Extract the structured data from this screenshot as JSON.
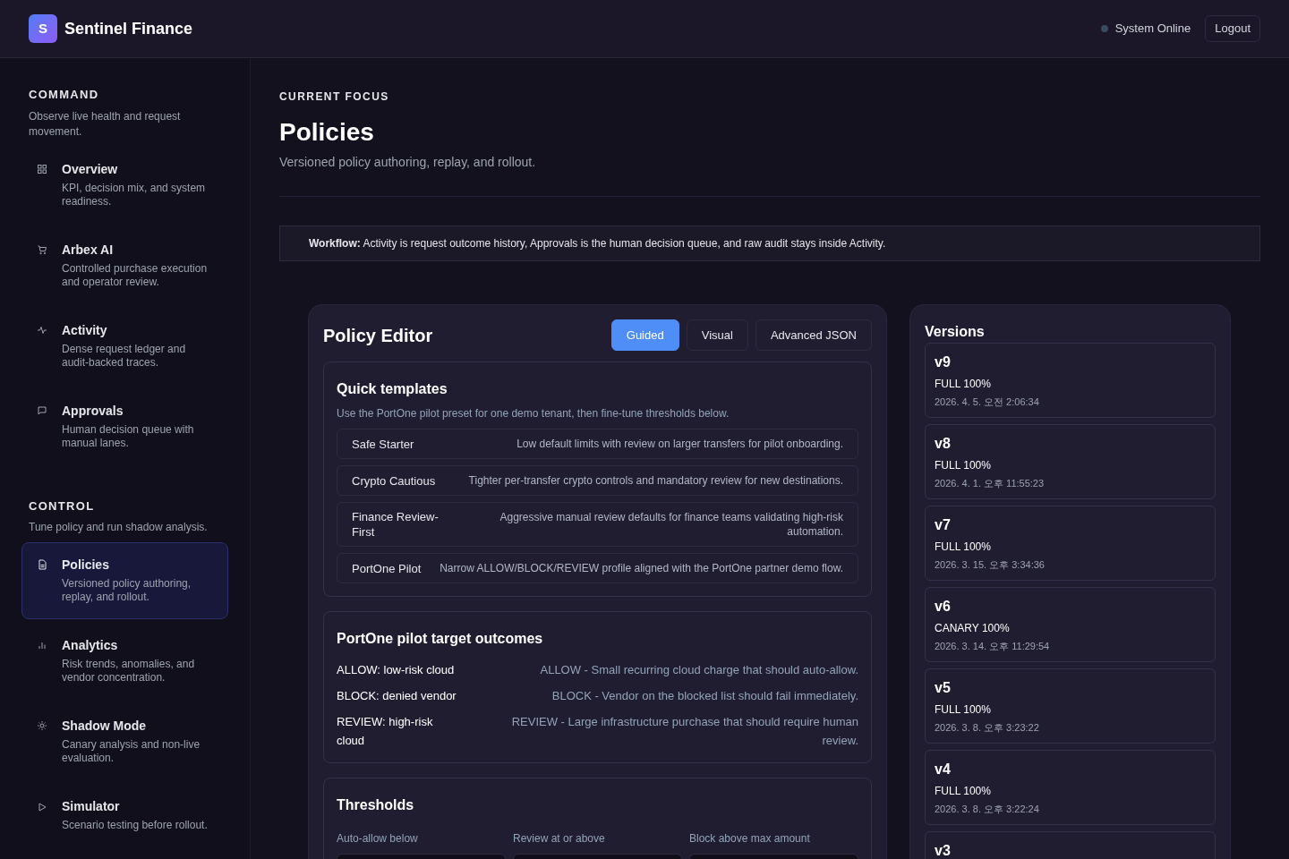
{
  "header": {
    "logo_letter": "S",
    "brand": "Sentinel Finance",
    "status": "System Online",
    "logout": "Logout"
  },
  "sidebar": {
    "sections": [
      {
        "title": "COMMAND",
        "subtitle": "Observe live health and request movement.",
        "items": [
          {
            "kind": "grid",
            "title": "Overview",
            "description": "KPI, decision mix, and system readiness.",
            "selected": false
          },
          {
            "kind": "cart",
            "title": "Arbex AI",
            "description": "Controlled purchase execution and operator review.",
            "selected": false
          },
          {
            "kind": "pulse",
            "title": "Activity",
            "description": "Dense request ledger and audit-backed traces.",
            "selected": false
          },
          {
            "kind": "chat",
            "title": "Approvals",
            "description": "Human decision queue with manual lanes.",
            "selected": false
          }
        ]
      },
      {
        "title": "CONTROL",
        "subtitle": "Tune policy and run shadow analysis.",
        "items": [
          {
            "kind": "doc",
            "title": "Policies",
            "description": "Versioned policy authoring, replay, and rollout.",
            "selected": true
          },
          {
            "kind": "bars",
            "title": "Analytics",
            "description": "Risk trends, anomalies, and vendor concentration.",
            "selected": false
          },
          {
            "kind": "sun",
            "title": "Shadow Mode",
            "description": "Canary analysis and non-live evaluation.",
            "selected": false
          },
          {
            "kind": "play",
            "title": "Simulator",
            "description": "Scenario testing before rollout.",
            "selected": false
          }
        ]
      }
    ]
  },
  "page": {
    "eyebrow": "CURRENT FOCUS",
    "title": "Policies",
    "subtitle": "Versioned policy authoring, replay, and rollout.",
    "workflow": "**Workflow:** Activity is request outcome history, Approvals is the human decision queue, and raw audit stays inside Activity."
  },
  "editor": {
    "title": "Policy Editor",
    "tabs": [
      {
        "label": "Guided",
        "selected": true
      },
      {
        "label": "Visual",
        "selected": false
      },
      {
        "label": "Advanced JSON",
        "selected": false
      }
    ],
    "templates": {
      "title": "Quick templates",
      "subtitle": "Use the PortOne pilot preset for one demo tenant, then fine-tune thresholds below.",
      "items": [
        {
          "name": "Safe Starter",
          "description": "Low default limits with review on larger transfers for pilot onboarding."
        },
        {
          "name": "Crypto Cautious",
          "description": "Tighter per-transfer crypto controls and mandatory review for new destinations."
        },
        {
          "name": "Finance Review-First",
          "description": "Aggressive manual review defaults for finance teams validating high-risk automation."
        },
        {
          "name": "PortOne Pilot",
          "description": "Narrow ALLOW/BLOCK/REVIEW profile aligned with the PortOne partner demo flow."
        }
      ]
    },
    "outcomes": {
      "title": "PortOne pilot target outcomes",
      "items": [
        {
          "label": "ALLOW: low-risk cloud",
          "description": "ALLOW - Small recurring cloud charge that should auto-allow."
        },
        {
          "label": "BLOCK: denied vendor",
          "description": "BLOCK - Vendor on the blocked list should fail immediately."
        },
        {
          "label": "REVIEW: high-risk cloud",
          "description": "REVIEW - Large infrastructure purchase that should require human review."
        }
      ]
    },
    "thresholds": {
      "title": "Thresholds",
      "fields": [
        {
          "label": "Auto-allow below"
        },
        {
          "label": "Review at or above"
        },
        {
          "label": "Block above max amount"
        }
      ]
    }
  },
  "versions": {
    "title": "Versions",
    "items": [
      {
        "version": "v9",
        "rollout": "FULL 100%",
        "timestamp": "2026. 4. 5. 오전 2:06:34"
      },
      {
        "version": "v8",
        "rollout": "FULL 100%",
        "timestamp": "2026. 4. 1. 오후 11:55:23"
      },
      {
        "version": "v7",
        "rollout": "FULL 100%",
        "timestamp": "2026. 3. 15. 오후 3:34:36"
      },
      {
        "version": "v6",
        "rollout": "CANARY 100%",
        "timestamp": "2026. 3. 14. 오후 11:29:54"
      },
      {
        "version": "v5",
        "rollout": "FULL 100%",
        "timestamp": "2026. 3. 8. 오후 3:23:22"
      },
      {
        "version": "v4",
        "rollout": "FULL 100%",
        "timestamp": "2026. 3. 8. 오후 3:22:24"
      },
      {
        "version": "v3"
      }
    ]
  }
}
